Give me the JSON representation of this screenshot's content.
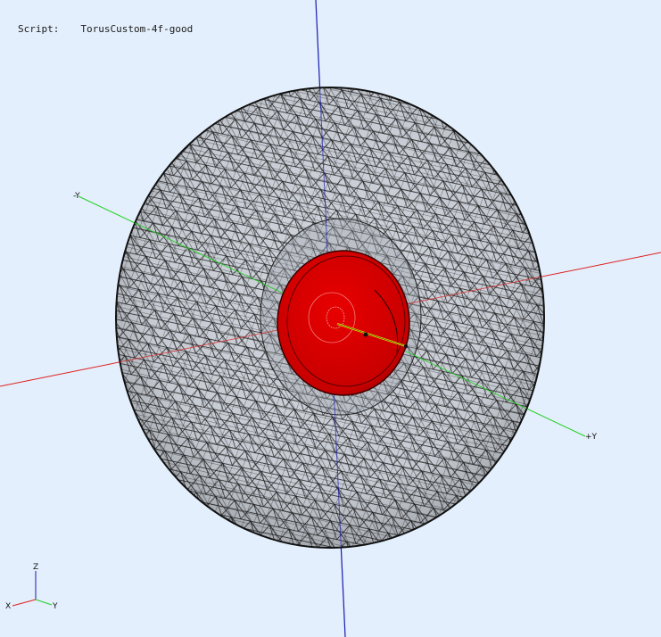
{
  "header": {
    "script_label": "Script:",
    "script_name": "TorusCustom-4f-good"
  },
  "axes": {
    "neg_y": "-Y",
    "pos_y": "+Y"
  },
  "triad": {
    "z": "Z",
    "x": "X",
    "y": "Y"
  },
  "colors": {
    "background": "#e3effc",
    "mesh_fill": "#cfd4dc",
    "mesh_edges": "#1b1b1b",
    "red_part": "#d40000",
    "x_axis": "#e02020",
    "y_axis": "#20d020",
    "z_axis": "#1a1ab0"
  }
}
